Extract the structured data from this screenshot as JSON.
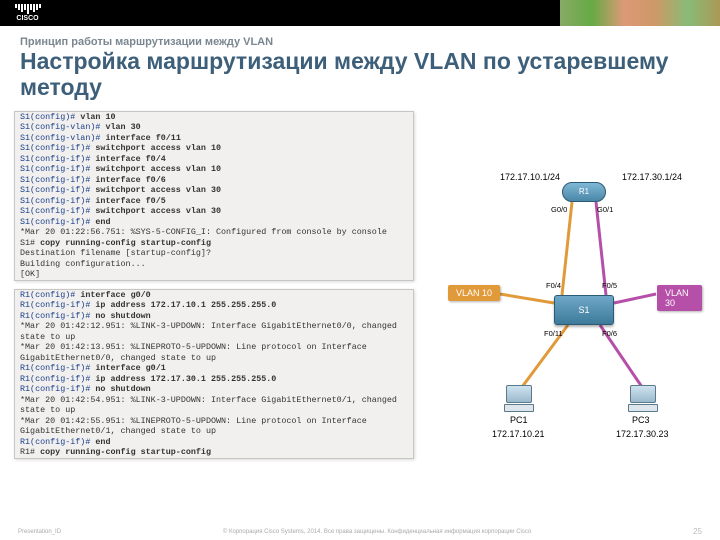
{
  "logo_text": "CISCO",
  "kicker": "Принцип работы маршрутизации между VLAN",
  "title": "Настройка маршрутизации между VLAN по устаревшему методу",
  "term1": [
    {
      "p": "S1(config)# ",
      "c": "vlan 10",
      "b": true
    },
    {
      "p": "S1(config-vlan)# ",
      "c": "vlan 30",
      "b": true
    },
    {
      "p": "S1(config-vlan)# ",
      "c": "interface f0/11",
      "b": true
    },
    {
      "p": "S1(config-if)# ",
      "c": "switchport access vlan 10",
      "b": true
    },
    {
      "p": "S1(config-if)# ",
      "c": "interface f0/4",
      "b": true
    },
    {
      "p": "S1(config-if)# ",
      "c": "switchport access vlan 10",
      "b": true
    },
    {
      "p": "S1(config-if)# ",
      "c": "interface f0/6",
      "b": true
    },
    {
      "p": "S1(config-if)# ",
      "c": "switchport access vlan 30",
      "b": true
    },
    {
      "p": "S1(config-if)# ",
      "c": "interface f0/5",
      "b": true
    },
    {
      "p": "S1(config-if)# ",
      "c": "switchport access vlan 30",
      "b": true
    },
    {
      "p": "S1(config-if)# ",
      "c": "end",
      "b": true
    },
    {
      "p": "",
      "c": "*Mar 20 01:22:56.751: %SYS-5-CONFIG_I: Configured from console by console",
      "b": false,
      "plain": true
    },
    {
      "p": "S1# ",
      "c": "copy running-config startup-config",
      "b": true,
      "blackp": true
    },
    {
      "p": "",
      "c": "Destination filename [startup-config]?",
      "plain": true
    },
    {
      "p": "",
      "c": "Building configuration...",
      "plain": true
    },
    {
      "p": "",
      "c": "[OK]",
      "plain": true
    }
  ],
  "term2": [
    {
      "p": "R1(config)# ",
      "c": "interface g0/0",
      "b": true
    },
    {
      "p": "R1(config-if)# ",
      "c": "ip address 172.17.10.1 255.255.255.0",
      "b": true
    },
    {
      "p": "R1(config-if)# ",
      "c": "no shutdown",
      "b": true
    },
    {
      "p": "",
      "c": "*Mar 20 01:42:12.951: %LINK-3-UPDOWN: Interface GigabitEthernet0/0, changed state to up",
      "plain": true
    },
    {
      "p": "",
      "c": "*Mar 20 01:42:13.951: %LINEPROTO-5-UPDOWN: Line protocol on Interface GigabitEthernet0/0, changed state to up",
      "plain": true
    },
    {
      "p": "R1(config-if)# ",
      "c": "interface g0/1",
      "b": true
    },
    {
      "p": "R1(config-if)# ",
      "c": "ip address 172.17.30.1 255.255.255.0",
      "b": true
    },
    {
      "p": "R1(config-if)# ",
      "c": "no shutdown",
      "b": true
    },
    {
      "p": "",
      "c": "*Mar 20 01:42:54.951: %LINK-3-UPDOWN: Interface GigabitEthernet0/1, changed state to up",
      "plain": true
    },
    {
      "p": "",
      "c": "*Mar 20 01:42:55.951: %LINEPROTO-5-UPDOWN: Line protocol on Interface GigabitEthernet0/1, changed state to up",
      "plain": true
    },
    {
      "p": "R1(config-if)# ",
      "c": "end",
      "b": true
    },
    {
      "p": "R1# ",
      "c": "copy running-config startup-config",
      "b": true,
      "blackp": true
    }
  ],
  "diagram": {
    "router_label": "R1",
    "switch_label": "S1",
    "router_ip_left": "172.17.10.1/24",
    "router_ip_right": "172.17.30.1/24",
    "router_port_left": "G0/0",
    "router_port_right": "G0/1",
    "sw_port_tl": "F0/4",
    "sw_port_tr": "F0/5",
    "sw_port_bl": "F0/11",
    "sw_port_br": "F0/6",
    "vlan10": "VLAN 10",
    "vlan30": "VLAN 30",
    "pc1": "PC1",
    "pc3": "PC3",
    "pc1_ip": "172.17.10.21",
    "pc3_ip": "172.17.30.23"
  },
  "footer_left": "Presentation_ID",
  "footer_right": "© Корпорация Cisco Systems, 2014. Все права защищены. Конфиденциальная информация корпорации Cisco",
  "page_number": "25"
}
